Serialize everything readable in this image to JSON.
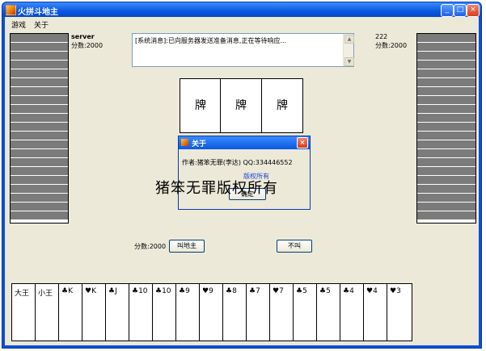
{
  "window": {
    "title": "火拼斗地主"
  },
  "menu": [
    {
      "label": "游戏"
    },
    {
      "label": "关于"
    }
  ],
  "players": {
    "left": {
      "name": "server",
      "score_text": "分数:2000"
    },
    "right": {
      "name": "222",
      "score_text": "分数:2000"
    },
    "me": {
      "score_text": "分数:2000"
    }
  },
  "message_box": {
    "text": "[系统消息]:已向服务器发送准备消息,正在等待响应..."
  },
  "center_cards": [
    "牌",
    "牌",
    "牌"
  ],
  "actions": {
    "call_landlord": "叫地主",
    "pass": "不叫"
  },
  "about_dialog": {
    "title": "关于",
    "author_line": "作者:猪笨无罪(李达)   QQ:334446552",
    "line2": "版权所有",
    "ok": "确定"
  },
  "watermark": "猪笨无罪版权所有",
  "hand_cards": [
    "大王",
    "小王",
    "♣K",
    "♥K",
    "♣J",
    "♣10",
    "♣10",
    "♣9",
    "♥9",
    "♣8",
    "♣7",
    "♥7",
    "♣5",
    "♣5",
    "♣4",
    "♥4",
    "♥3"
  ]
}
